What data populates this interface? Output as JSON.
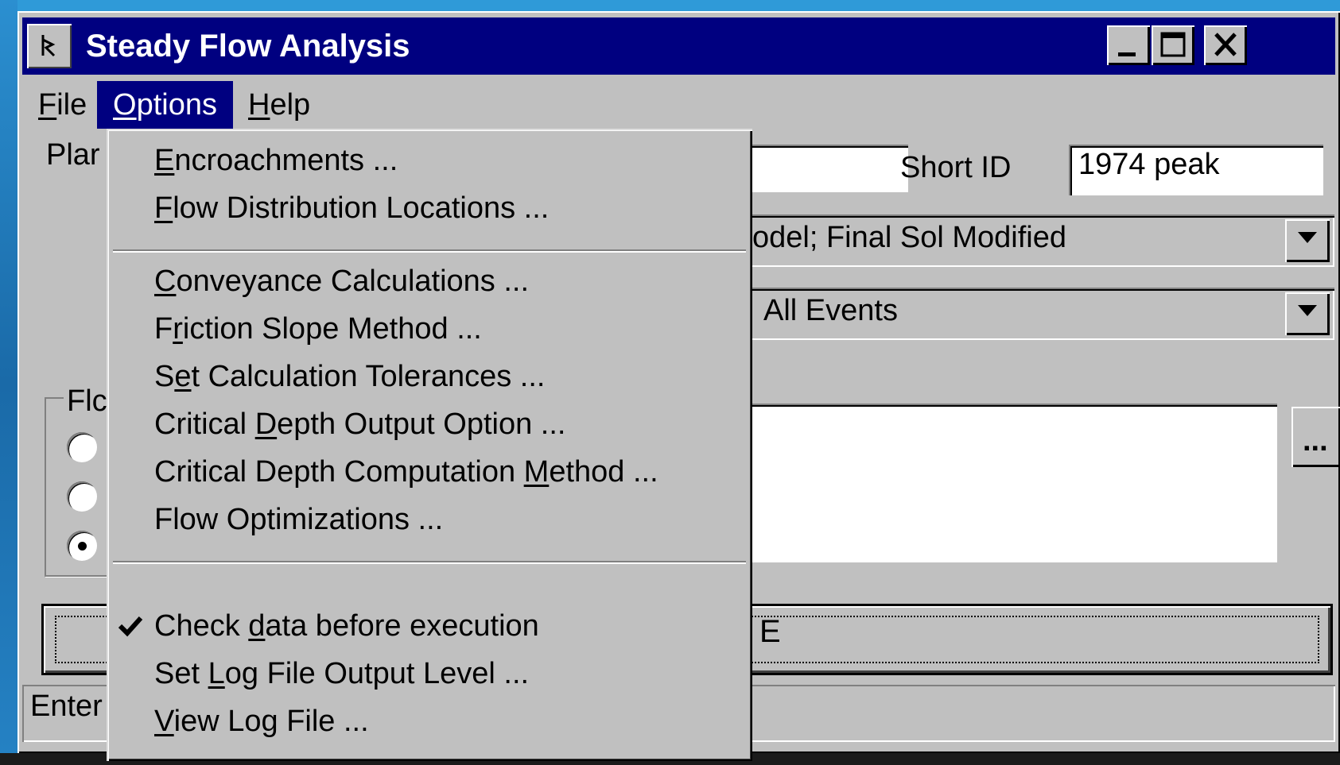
{
  "window": {
    "title": "Steady Flow Analysis",
    "controls": {
      "minimize": "minimize-icon",
      "maximize": "maximize-icon",
      "close": "close-icon"
    }
  },
  "menubar": {
    "items": [
      {
        "label": "File",
        "mnemonic": "F",
        "rest": "ile"
      },
      {
        "label": "Options",
        "mnemonic": "O",
        "rest": "ptions",
        "active": true
      },
      {
        "label": "Help",
        "mnemonic": "H",
        "rest": "elp"
      }
    ]
  },
  "form": {
    "plan_label_visible": "Plar",
    "short_id_label": "Short ID",
    "short_id_value": "1974 peak",
    "geometry_combo_visible": "odel; Final Sol Modified",
    "flow_combo_visible": "All Events",
    "flow_group_title_visible": "Flc",
    "radios": [
      {
        "checked": false
      },
      {
        "checked": false
      },
      {
        "checked": true
      }
    ],
    "ellipsis_label": "...",
    "compute_visible_char": "E"
  },
  "status": {
    "text_visible": "Enter"
  },
  "options_menu": {
    "items": [
      {
        "pre": "",
        "u": "E",
        "post": "ncroachments ...",
        "label": "Encroachments ..."
      },
      {
        "pre": "",
        "u": "F",
        "post": "low Distribution Locations ...",
        "label": "Flow Distribution Locations ..."
      },
      {
        "pre": "",
        "u": "C",
        "post": "onveyance Calculations ...",
        "label": "Conveyance Calculations ..."
      },
      {
        "pre": "F",
        "u": "r",
        "post": "iction Slope Method ...",
        "label": "Friction Slope Method ..."
      },
      {
        "pre": "S",
        "u": "e",
        "post": "t Calculation Tolerances ...",
        "label": "Set Calculation Tolerances ..."
      },
      {
        "pre": "Critical ",
        "u": "D",
        "post": "epth Output Option ...",
        "label": "Critical Depth Output Option ..."
      },
      {
        "pre": "Critical Depth Computation ",
        "u": "M",
        "post": "ethod ...",
        "label": "Critical Depth Computation Method ..."
      },
      {
        "pre": "Flow Optimizations ...",
        "u": "",
        "post": "",
        "label": "Flow Optimizations ..."
      },
      {
        "pre": "Check ",
        "u": "d",
        "post": "ata before execution",
        "label": "Check data before execution",
        "checked": true
      },
      {
        "pre": "Set ",
        "u": "L",
        "post": "og File Output Level ...",
        "label": "Set Log File Output Level ..."
      },
      {
        "pre": "",
        "u": "V",
        "post": "iew Log File ...",
        "label": "View Log File ..."
      }
    ]
  },
  "colors": {
    "titlebar": "#000080",
    "face": "#c0c0c0",
    "highlight": "#000080",
    "desktop": "#1f6fb0"
  }
}
